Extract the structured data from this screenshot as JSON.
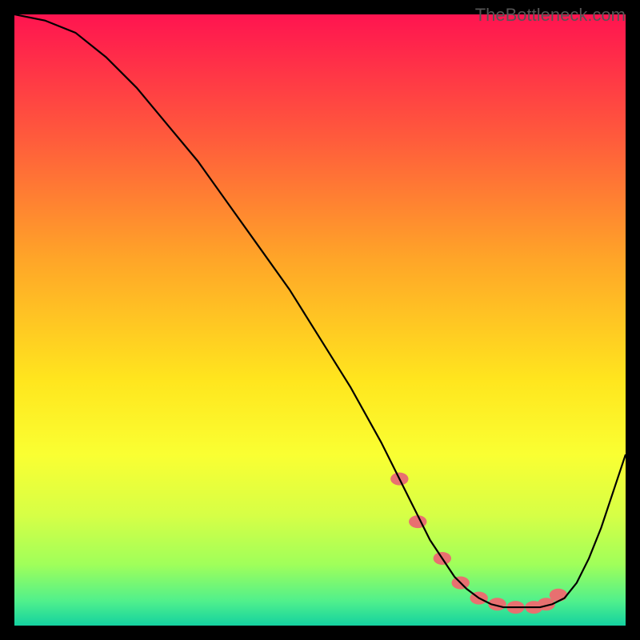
{
  "watermark": "TheBottleneck.com",
  "chart_data": {
    "type": "line",
    "title": "",
    "xlabel": "",
    "ylabel": "",
    "xlim": [
      0,
      100
    ],
    "ylim": [
      0,
      100
    ],
    "gradient_stops": [
      {
        "offset": 0,
        "color": "#ff1450"
      },
      {
        "offset": 20,
        "color": "#ff5a3c"
      },
      {
        "offset": 40,
        "color": "#ffa528"
      },
      {
        "offset": 60,
        "color": "#ffe61e"
      },
      {
        "offset": 72,
        "color": "#faff32"
      },
      {
        "offset": 82,
        "color": "#d6ff46"
      },
      {
        "offset": 90,
        "color": "#a0ff5a"
      },
      {
        "offset": 96,
        "color": "#50f08c"
      },
      {
        "offset": 100,
        "color": "#14d2a0"
      }
    ],
    "series": [
      {
        "name": "bottleneck-curve",
        "color": "#000000",
        "x": [
          0,
          5,
          10,
          15,
          20,
          25,
          30,
          35,
          40,
          45,
          50,
          55,
          60,
          63,
          65,
          68,
          70,
          72,
          74,
          76,
          78,
          80,
          82,
          84,
          86,
          88,
          90,
          92,
          94,
          96,
          98,
          100
        ],
        "y": [
          100,
          99,
          97,
          93,
          88,
          82,
          76,
          69,
          62,
          55,
          47,
          39,
          30,
          24,
          20,
          14,
          11,
          8,
          6,
          4.5,
          3.5,
          3,
          3,
          3,
          3,
          3.5,
          4.5,
          7,
          11,
          16,
          22,
          28
        ]
      }
    ],
    "markers": {
      "name": "highlight-dots",
      "color": "#e87070",
      "radius": 8,
      "elongated": true,
      "x": [
        63,
        66,
        70,
        73,
        76,
        79,
        82,
        85,
        87,
        89
      ],
      "y": [
        24,
        17,
        11,
        7,
        4.5,
        3.5,
        3,
        3,
        3.5,
        5
      ]
    }
  }
}
